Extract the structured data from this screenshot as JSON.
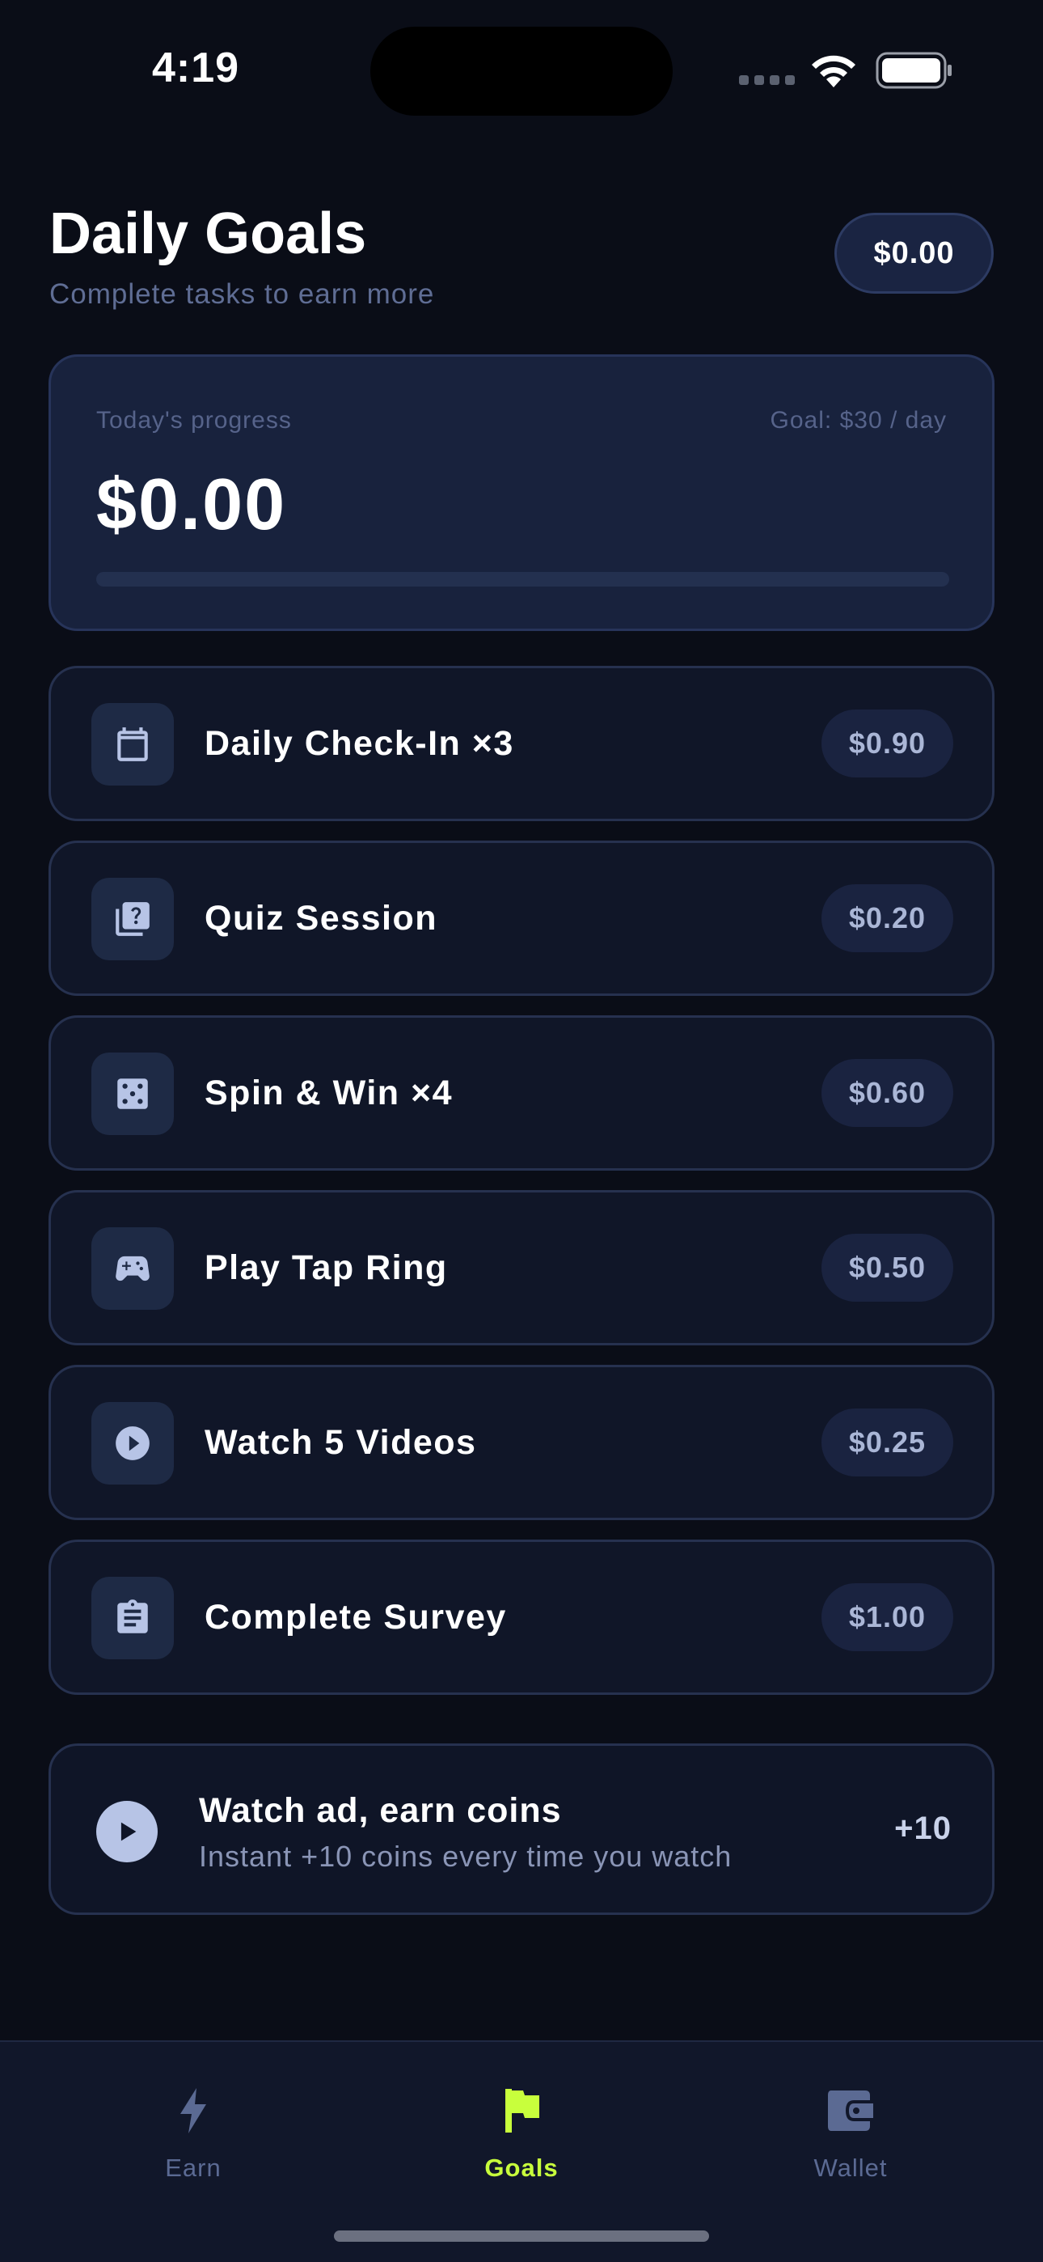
{
  "status_bar": {
    "time": "4:19"
  },
  "header": {
    "title": "Daily Goals",
    "subtitle": "Complete tasks to earn more",
    "balance": "$0.00"
  },
  "progress": {
    "label": "Today's progress",
    "goal": "Goal: $30 / day",
    "amount": "$0.00",
    "fraction": 0
  },
  "tasks": [
    {
      "label": "Daily Check-In ×3",
      "reward": "$0.90",
      "icon": "calendar-icon"
    },
    {
      "label": "Quiz Session",
      "reward": "$0.20",
      "icon": "quiz-icon"
    },
    {
      "label": "Spin & Win ×4",
      "reward": "$0.60",
      "icon": "dice-icon"
    },
    {
      "label": "Play Tap Ring",
      "reward": "$0.50",
      "icon": "gamepad-icon"
    },
    {
      "label": "Watch 5 Videos",
      "reward": "$0.25",
      "icon": "play-circle-icon"
    },
    {
      "label": "Complete Survey",
      "reward": "$1.00",
      "icon": "clipboard-icon"
    }
  ],
  "ad": {
    "title": "Watch ad, earn coins",
    "subtitle": "Instant +10 coins every time you watch",
    "bonus": "+10"
  },
  "tab_bar": {
    "items": [
      {
        "label": "Earn",
        "icon": "lightning-icon",
        "active": false
      },
      {
        "label": "Goals",
        "icon": "flag-icon",
        "active": true
      },
      {
        "label": "Wallet",
        "icon": "wallet-icon",
        "active": false
      }
    ]
  },
  "colors": {
    "background": "#0a0d17",
    "card": "#101628",
    "accent": "#c8ff3c",
    "muted": "#5f6d94"
  }
}
